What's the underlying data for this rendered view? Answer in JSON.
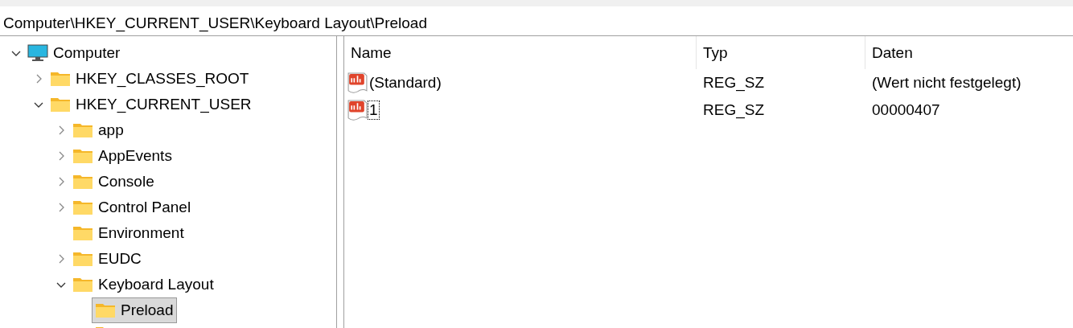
{
  "address_bar": {
    "path": "Computer\\HKEY_CURRENT_USER\\Keyboard Layout\\Preload"
  },
  "tree": [
    {
      "label": "Computer",
      "kind": "computer",
      "expanded": true,
      "selected": false,
      "children": [
        {
          "label": "HKEY_CLASSES_ROOT",
          "kind": "folder",
          "expanded": false,
          "selected": false
        },
        {
          "label": "HKEY_CURRENT_USER",
          "kind": "folder",
          "expanded": true,
          "selected": false,
          "children": [
            {
              "label": "app",
              "kind": "folder",
              "expanded": false,
              "selected": false
            },
            {
              "label": "AppEvents",
              "kind": "folder",
              "expanded": false,
              "selected": false
            },
            {
              "label": "Console",
              "kind": "folder",
              "expanded": false,
              "selected": false
            },
            {
              "label": "Control Panel",
              "kind": "folder",
              "expanded": false,
              "selected": false
            },
            {
              "label": "Environment",
              "kind": "folder",
              "selected": false
            },
            {
              "label": "EUDC",
              "kind": "folder",
              "expanded": false,
              "selected": false
            },
            {
              "label": "Keyboard Layout",
              "kind": "folder",
              "expanded": true,
              "selected": false,
              "children": [
                {
                  "label": "Preload",
                  "kind": "folder",
                  "selected": true
                },
                {
                  "kind": "folder",
                  "selected": false
                }
              ]
            }
          ]
        }
      ]
    }
  ],
  "values_table": {
    "columns": [
      "Name",
      "Typ",
      "Daten"
    ],
    "rows": [
      {
        "name": "(Standard)",
        "type": "REG_SZ",
        "data": "(Wert nicht festgelegt)",
        "focused": false
      },
      {
        "name": "1",
        "type": "REG_SZ",
        "data": "00000407",
        "focused": true
      }
    ]
  }
}
